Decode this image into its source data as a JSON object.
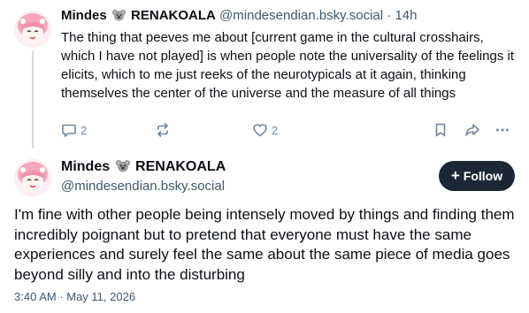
{
  "reply_post": {
    "author_name": "Mindes",
    "author_suffix": "RENAKOALA",
    "author_handle": "@mindesendian.bsky.social",
    "separator": "·",
    "time_ago": "14h",
    "text": "The thing that peeves me about [current game in the cultural crosshairs, which I have not played] is when people note the universality of the feelings it elicits, which to me just reeks of the neurotypicals at it again, thinking themselves the center of the universe and the measure of all things",
    "reply_count": "2",
    "like_count": "2"
  },
  "main_post": {
    "author_name": "Mindes",
    "author_suffix": "RENAKOALA",
    "author_handle": "@mindesendian.bsky.social",
    "follow_label": "Follow",
    "text": "I'm fine with other people being intensely moved by things and finding them incredibly poignant but to pretend that everyone must have the same experiences and surely feel the same about the same piece of media goes beyond silly and into the disturbing",
    "timestamp": "3:40 AM · May 11, 2026"
  },
  "icons": [
    "koala-emoji-icon",
    "reply-icon",
    "repost-icon",
    "like-icon",
    "bookmark-icon",
    "share-icon",
    "more-icon",
    "plus-icon"
  ],
  "colors": {
    "text": "#0b0f14",
    "muted": "#42576c",
    "icon": "#6f869f",
    "follow_bg": "#1b2735",
    "thread_line": "#d4dbe2",
    "avatar_hair": "#f4a6bd"
  }
}
